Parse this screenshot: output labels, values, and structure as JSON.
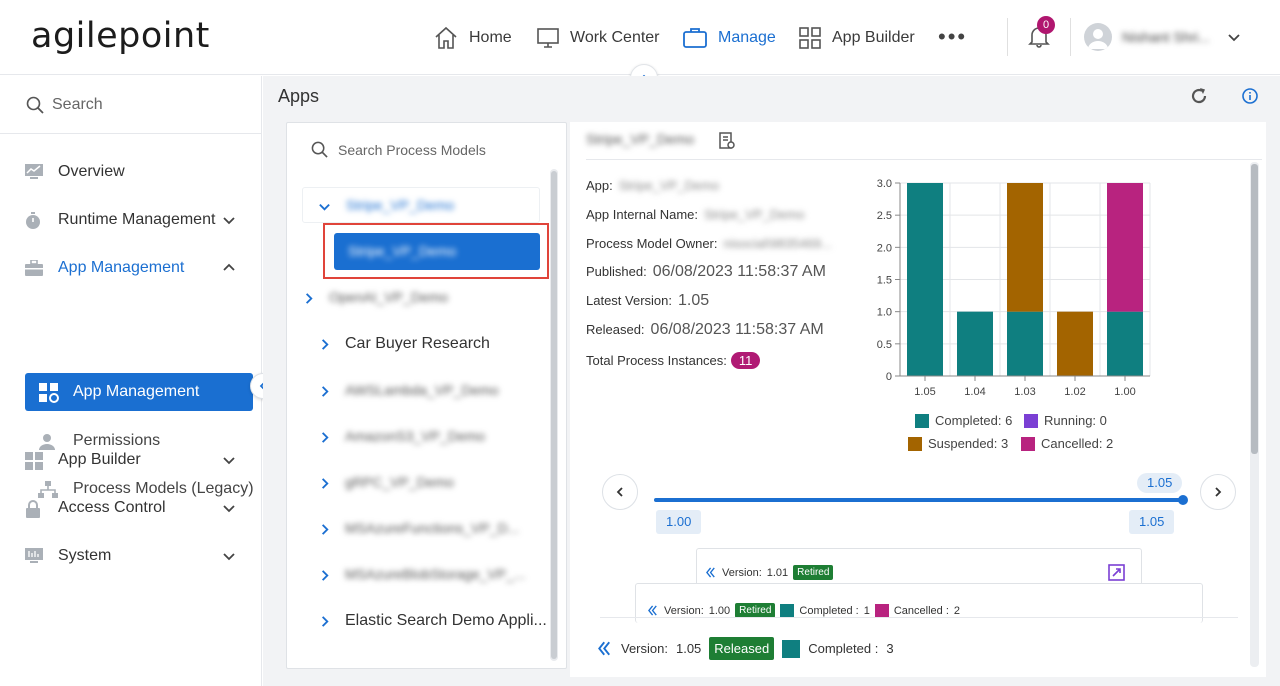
{
  "brand": {
    "logo_text": "agilepoint"
  },
  "topnav": {
    "home": "Home",
    "work_center": "Work Center",
    "manage": "Manage",
    "app_builder": "App Builder",
    "notifications_count": "0",
    "user_name": "Nishant Shri..."
  },
  "sidebar": {
    "search_placeholder": "Search",
    "items": {
      "overview": "Overview",
      "runtime_management": "Runtime Management",
      "app_management": "App Management",
      "app_management_sub": "App Management",
      "permissions": "Permissions",
      "process_models_legacy": "Process Models (Legacy)",
      "app_builder": "App Builder",
      "access_control": "Access Control",
      "system": "System"
    }
  },
  "page": {
    "title": "Apps"
  },
  "tree": {
    "search_placeholder": "Search Process Models",
    "parent_label": "Stripe_VP_Demo",
    "selected_label": "Stripe_VP_Demo",
    "items": [
      "OpenAI_VP_Demo",
      "Car Buyer Research",
      "AWSLambda_VP_Demo",
      "AmazonS3_VP_Demo",
      "gRPC_VP_Demo",
      "MSAzureFunctions_VP_D...",
      "MSAzureBlobStorage_VP_...",
      "Elastic Search Demo Appli..."
    ]
  },
  "details": {
    "header": "Stripe_VP_Demo",
    "app_label": "App:",
    "app_value": "Stripe_VP_Demo",
    "internal_name_label": "App Internal Name:",
    "internal_name_value": "Stripe_VP_Demo",
    "owner_label": "Process Model Owner:",
    "owner_value": "nisocial\\9835469...",
    "published_label": "Published:",
    "published_value": "06/08/2023 11:58:37 AM",
    "latest_version_label": "Latest Version:",
    "latest_version_value": "1.05",
    "released_label": "Released:",
    "released_value": "06/08/2023 11:58:37 AM",
    "total_instances_label": "Total Process Instances:",
    "total_instances_value": "11"
  },
  "chart_data": {
    "type": "bar",
    "stacked": true,
    "categories": [
      "1.05",
      "1.04",
      "1.03",
      "1.02",
      "1.00"
    ],
    "ylim": [
      0,
      3.0
    ],
    "yticks": [
      "3.0",
      "2.5",
      "2.0",
      "1.5",
      "1.0",
      "0.5",
      "0"
    ],
    "series": [
      {
        "name": "Completed",
        "color": "#0f7f80",
        "values": [
          3,
          1,
          1,
          0,
          1
        ]
      },
      {
        "name": "Running",
        "color": "#7b3fd4",
        "values": [
          0,
          0,
          0,
          0,
          0
        ]
      },
      {
        "name": "Suspended",
        "color": "#a36400",
        "values": [
          0,
          0,
          2,
          1,
          0
        ]
      },
      {
        "name": "Cancelled",
        "color": "#b8237f",
        "values": [
          0,
          0,
          0,
          0,
          2
        ]
      }
    ],
    "legend": [
      "Completed: 6",
      "Running: 0",
      "Suspended: 3",
      "Cancelled: 2"
    ]
  },
  "slider": {
    "current": "1.05",
    "min_label": "1.00",
    "max_label": "1.05"
  },
  "cards": {
    "card1": {
      "version_label": "Version:",
      "version_value": "1.01",
      "status": "Retired"
    },
    "card2": {
      "version_label": "Version:",
      "version_value": "1.00",
      "status": "Retired",
      "completed_label": "Completed :",
      "completed_value": "1",
      "cancelled_label": "Cancelled :",
      "cancelled_value": "2"
    },
    "bottom": {
      "version_label": "Version:",
      "version_value": "1.05",
      "status": "Released",
      "completed_label": "Completed :",
      "completed_value": "3"
    }
  }
}
